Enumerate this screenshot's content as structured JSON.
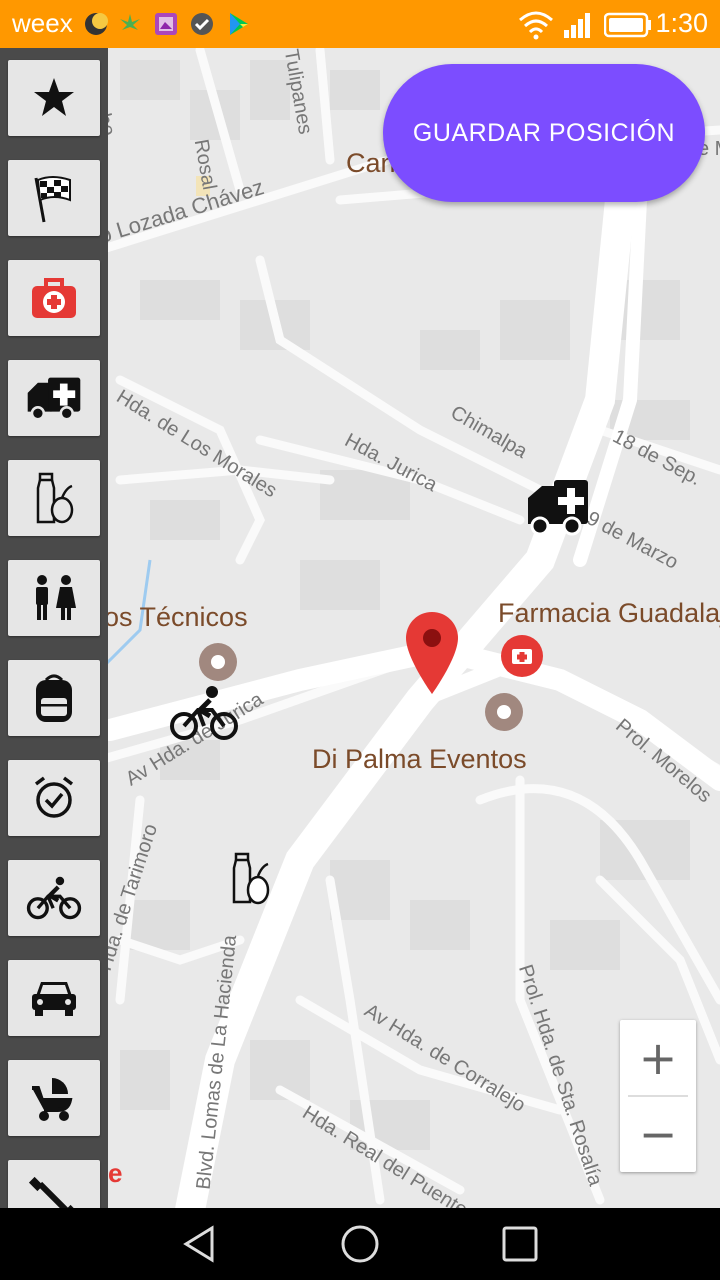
{
  "status_bar": {
    "app_name": "weex",
    "time": "1:30",
    "notification_icons": [
      "moon-icon",
      "cannabis-icon",
      "image-icon",
      "check-icon",
      "play-store-icon"
    ],
    "system_icons": [
      "wifi-icon",
      "signal-icon",
      "battery-icon"
    ]
  },
  "map": {
    "streets": [
      "Nube",
      "Rosal",
      "Tulipanes",
      "Francisco Lozada Chávez",
      "Hda. de Los Morales",
      "Hda. Jurica",
      "Chimalpa",
      "18 de Sep.",
      "9 de Marzo",
      "Av Hda. de Jurica",
      "Prol. Morelos",
      "Av Hda. de Tarimoro",
      "Blvd. Lomas de La Hacienda",
      "Av Hda. de Corralejo",
      "Prol. Hda. de Sta. Rosalía",
      "Hda. Real del Puente"
    ],
    "partial_label_top": "Can",
    "partial_label_right": "e M",
    "pois": {
      "tecnicos": "os Técnicos",
      "farmacia": "Farmacia Guadalaj",
      "di_palma": "Di Palma Eventos"
    },
    "google_logo_fragment": "e"
  },
  "save_button": {
    "label": "GUARDAR POSICIÓN"
  },
  "sidebar": {
    "items": [
      {
        "icon": "star-icon"
      },
      {
        "icon": "checkered-flag-icon"
      },
      {
        "icon": "first-aid-kit-icon"
      },
      {
        "icon": "ambulance-icon"
      },
      {
        "icon": "bottle-fruit-icon"
      },
      {
        "icon": "restroom-icon"
      },
      {
        "icon": "backpack-icon"
      },
      {
        "icon": "alarm-clock-icon"
      },
      {
        "icon": "bicycle-icon"
      },
      {
        "icon": "car-icon"
      },
      {
        "icon": "stroller-icon"
      },
      {
        "icon": "dumbbell-icon"
      }
    ]
  },
  "map_markers": [
    "ambulance-marker",
    "bicycle-marker",
    "bottle-fruit-marker",
    "location-pin"
  ],
  "zoom": {
    "in_label": "+",
    "out_label": "−"
  },
  "navbar": [
    "back-icon",
    "home-icon",
    "recents-icon"
  ],
  "colors": {
    "status_bar": "#FF9800",
    "save_button": "#7C4DFF",
    "pin": "#E53935",
    "first_aid": "#E53935",
    "sidebar_bg": "#4a4a4a"
  }
}
